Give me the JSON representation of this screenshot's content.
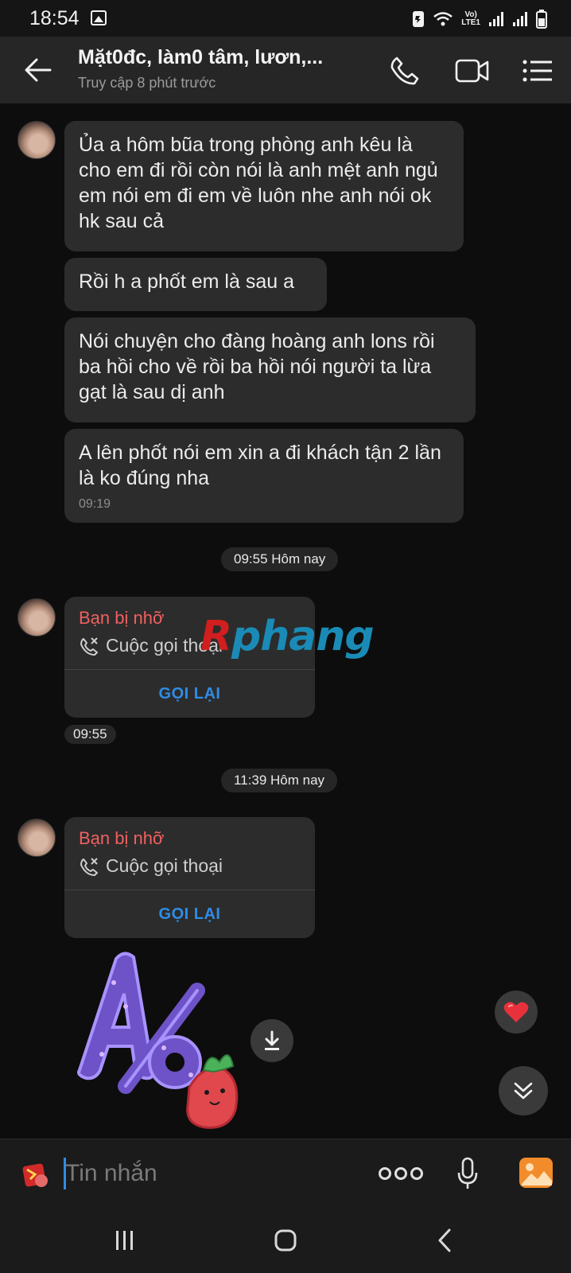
{
  "status_bar": {
    "time": "18:54",
    "network_label_top": "Vo)",
    "network_label_bottom": "LTE1"
  },
  "header": {
    "title": "Mặt0đc, làm0 tâm, lươn,...",
    "subtitle": "Truy cập 8 phút trước"
  },
  "messages": [
    {
      "text": "Ủa a hôm bũa trong phòng anh kêu là cho em đi rồi còn nói là anh mệt anh ngủ em nói em đi em về luôn nhe anh nói ok hk sau cả"
    },
    {
      "text": "Rồi h a phốt em là sau a"
    },
    {
      "text": "Nói chuyện cho đàng hoàng anh lons rồi ba hồi cho về rồi ba hồi nói người ta lừa gạt là sau dị anh"
    },
    {
      "text": "A lên phốt nói em xin a đi khách tận 2 lần là ko đúng nha",
      "time": "09:19"
    }
  ],
  "separators": [
    "09:55 Hôm nay",
    "11:39 Hôm nay"
  ],
  "missed_calls": [
    {
      "title": "Bạn bị nhỡ",
      "subtitle": "Cuộc gọi thoại",
      "action": "GỌI LẠI",
      "time": "09:55"
    },
    {
      "title": "Bạn bị nhỡ",
      "subtitle": "Cuộc gọi thoại",
      "action": "GỌI LẠI"
    }
  ],
  "watermark": {
    "prefix": "R",
    "rest": "phang"
  },
  "sticker": {
    "text": "A lô"
  },
  "composer": {
    "placeholder": "Tin nhắn"
  },
  "colors": {
    "background": "#0d0d0d",
    "bubble": "#2c2c2c",
    "header": "#262626",
    "missed_red": "#f0605f",
    "action_blue": "#2f8ce6"
  },
  "icons": {
    "back": "arrow-left-icon",
    "call": "phone-icon",
    "video": "video-camera-icon",
    "menu": "list-icon",
    "missed_call": "missed-call-icon",
    "download": "download-icon",
    "reaction": "heart-icon",
    "scroll": "double-chevron-down-icon",
    "mic": "microphone-icon",
    "image": "image-icon"
  }
}
